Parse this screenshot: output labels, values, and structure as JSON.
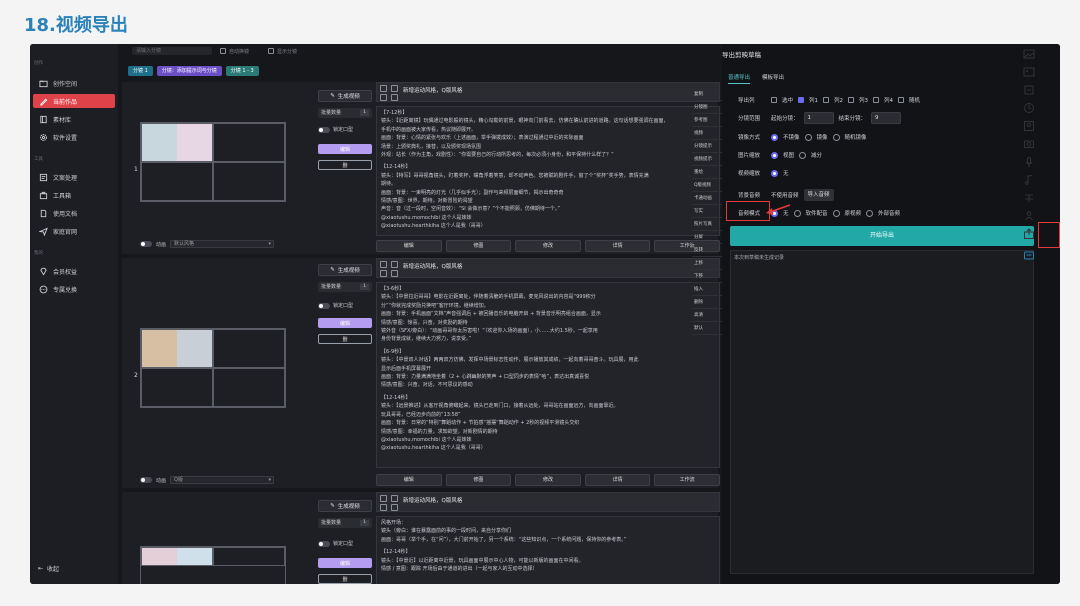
{
  "page_title": "18.视频导出",
  "sidebar": {
    "group1": "创作",
    "items_top": [
      {
        "label": "创作空间",
        "icon": "folder-icon"
      },
      {
        "label": "当前作品",
        "icon": "pencil-icon",
        "active": true
      },
      {
        "label": "素材库",
        "icon": "book-icon"
      },
      {
        "label": "软件设置",
        "icon": "gear-icon"
      }
    ],
    "group2": "工具",
    "items_tools": [
      {
        "label": "文案处理",
        "icon": "edit-icon"
      },
      {
        "label": "工具箱",
        "icon": "toolbox-icon"
      },
      {
        "label": "使用文档",
        "icon": "doc-icon"
      },
      {
        "label": "家庭官网",
        "icon": "send-icon"
      }
    ],
    "group3": "我的",
    "items_mine": [
      {
        "label": "会员权益",
        "icon": "diamond-icon"
      },
      {
        "label": "专属兑换",
        "icon": "more-icon"
      }
    ],
    "collapse": "收起"
  },
  "topbar": {
    "search_placeholder": "请输入分镜",
    "toggle1": "自动换镜",
    "toggle2": "显示分镜"
  },
  "chips": [
    "分镜 1",
    "分镜：添加提示词与分镜",
    "分镜 1 - 3"
  ],
  "scenes": [
    {
      "num": "1",
      "gen": "生成视频",
      "count_label": "批量数量",
      "count": "1",
      "toggle": "锁定口型",
      "purple": "编辑",
      "outline": "删",
      "title": "新增运动风格，Q版风格",
      "lines": [
        "【7-12秒】",
        "镜头：【近距离镜】玩偶通过电影般的镜头，精心勾勒的前景，眼神向门前看去，仿佛在确认前进的道路。这句话想要强调在画面，",
        "手机中的画面被大家传看，热议随即展开。",
        "画面：背景：心情的紧张与欢乐（上述画面，举手弹拨成效）；表演过程通过中近的实际画面",
        "场景：上颁奖典礼，接替，以及颁奖现场氛围",
        "外观：站长（作为主角，戏剧性）：“你需要自己的行动所思考的，每次必须小身份，和平保持什么样了？”",
        "",
        "【12-14秒】",
        "镜头：【特写】哥哥视角镜头，盯着奖杯，嘴角浮着笑意，却不动声色。您被赋的剧件手，窗了个“奖杯”奖手势，表情充满",
        "期待。",
        "画面：背景：一束明亮的灯光（几乎似手光）；副作与来频层面细节，揭示出奇奇奇",
        "情感/意图：世界，期待，对新冒险的渴望",
        "声音：音（过一段时，空闲音效）：“SI 会做示意？”个不能照顾，仿佛期待一个。”",
        "@xiaotushu.momochibi 这个人是妹妹",
        "@xiaotushu.hearthkiha 这个人是我（哥哥）"
      ],
      "actions": [
        "编辑",
        "修图",
        "修改",
        "详情",
        "工作流"
      ],
      "footer_select": "默认风格",
      "footer_label": "动画"
    },
    {
      "num": "2",
      "gen": "生成视频",
      "count_label": "批量数量",
      "count": "1",
      "toggle": "锁定口型",
      "purple": "编辑",
      "outline": "删",
      "title": "新增运动风格，Q版风格",
      "lines": [
        "【3-6秒】",
        "镜头：【中景拉近哥哥】电影在近距离处，伴随着清脆的手机屏幕，麦克风说出的内容是“999积分",
        "分”“你就完成奖励兑换吧”客厅环境，继续增加。",
        "画面：背景：手机画面“文档”声音强调后 + 被回播音乐的电脑开启 + 背景音乐明亮组合画面，显示",
        "情感/意图：惊喜，兴奋，对奖励的期待",
        "镜外音（SFX/旁白）：“动画哥哥你太厉害啦！”（欢迎你入场的画面），小……大约1.5秒，一起享用",
        "身份背景成就，继续大力努力，说享受。”",
        "",
        "【6-9秒】",
        "镜头：【中景双人对话】两两双方仿佛，发挥中场景标志性动作，展示播放其成绩，一起向着哥哥奋斗。玩具展，用此",
        "显示后面手机屏幕展开",
        "画面：背景：力量满满地坐着（2 + 心跳幽默的笑声 + 口型同步的表情“哈”，表达出真诚喜悦",
        "情感/意图：兴奋，对话，不可思议的感动",
        "",
        "【12-14秒】",
        "镜头：【远景推进】从客厅视角俯瞰起来，镜头已走到门口，接着从远处，哥哥站在画面远方，向画面靠近。",
        "玩具哥哥，已经迈步向前的“13:58”",
        "画面：背景：日常的“特别”舞蹈动作 + 节拍感“摇摆”舞蹈动作 + 2秒的视频平滑镜头交织",
        "情感/意图：幸福的力量，求知欲望，对新剧情的期待",
        "@xiaotushu.momochibi 这个人是妹妹",
        "@xiaotushu.hearthkiha 这个人是我（哥哥）"
      ],
      "actions": [
        "编辑",
        "修图",
        "修改",
        "详情",
        "工作流"
      ],
      "footer_select": "Q版",
      "footer_label": "动画"
    },
    {
      "num": "3",
      "gen": "生成视频",
      "count_label": "批量数量",
      "count": "1",
      "toggle": "锁定口型",
      "purple": "编辑",
      "outline": "删",
      "title": "新增运动风格，Q版风格",
      "lines": [
        "风格开场：",
        "镜头（旁白：谁在暴露面前的事的一段时间，来自分享你们",
        "画面：哥哥（举个手，在“问”），大门前开始了，另一个系统：“这些知识点，一个系统问题，保持你的参考表。”",
        "",
        "【12-14秒】",
        "镜头：【中景近】以近距离中近景，玩具画面中展示中心人物，可能以新版的画面在中间看。",
        "情感 / 意图：跟踪 开场后由于通道的进出（一起与家人的互动中选择）"
      ],
      "actions": [
        "编辑",
        "修图",
        "修改",
        "详情",
        "工作流"
      ],
      "footer_select": "",
      "footer_label": ""
    }
  ],
  "right_col": [
    "复制",
    "分镜图",
    "参考图",
    "视频",
    "分镜提示",
    "视频提示",
    "重绘",
    "Q版视频",
    "卡通动画",
    "写实",
    "照片写真",
    "分屏",
    "反转",
    "上移",
    "下移",
    "插入",
    "删除",
    "高清",
    "默认"
  ],
  "panel": {
    "title": "导出剪映草稿",
    "tabs": [
      "普通导出",
      "模板导出"
    ],
    "rows": {
      "ratio_label": "导出列",
      "ratio_opts": [
        "选中",
        "列1",
        "列2",
        "列3",
        "列4",
        "随机"
      ],
      "split_label": "分镜范围",
      "start_label": "起始分镜：",
      "start": "1",
      "end_label": "结束分镜：",
      "end": "9",
      "speed_label": "镜像方式",
      "speed_opts": [
        "不镜像",
        "镜像",
        "随机镜像"
      ],
      "pic_label": "图片缩放",
      "pic_opts": [
        "视图",
        "减分"
      ],
      "vid_label": "视频缩放",
      "vid_opts": [
        "无"
      ],
      "bgm_label": "背景音频",
      "bgm_value": "不使用音频",
      "bgm_btn": "导入音频",
      "audio_label": "音频模式",
      "audio_opts": [
        "无",
        "软件配音",
        "原视频",
        "外部音频"
      ]
    },
    "start_btn": "开始导出",
    "log_text": "本次到草稿未生成记录"
  },
  "right_icons": [
    "image-icon",
    "image-icon",
    "refresh-icon",
    "diamond-icon",
    "person-icon",
    "camera-icon",
    "mic-icon",
    "music-icon",
    "text-icon",
    "person-icon",
    "export-icon",
    "message-icon"
  ],
  "colors": {
    "accent": "#23a8a8",
    "active": "#e0424a",
    "highlight": "#e23b3b",
    "title": "#2a82b8"
  }
}
